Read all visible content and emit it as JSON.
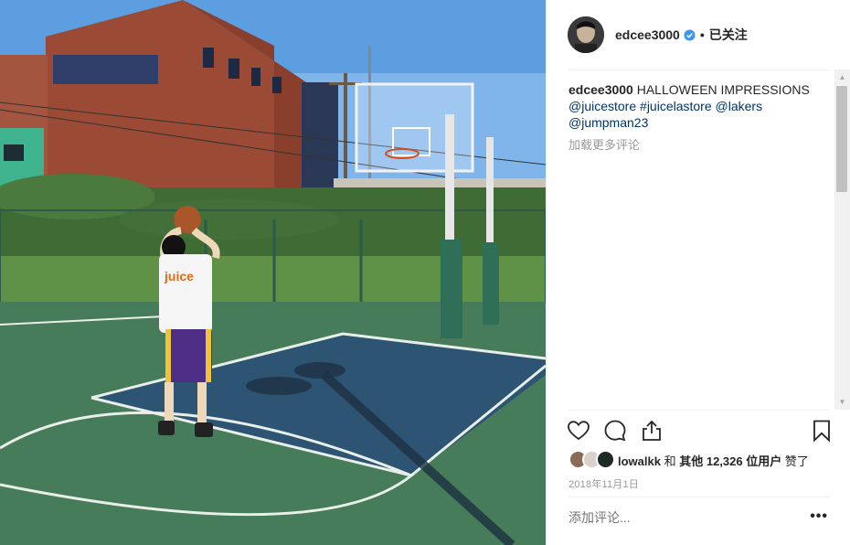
{
  "post": {
    "username": "edcee3000",
    "follow_state": "已关注",
    "separator": "•",
    "caption_text": "HALLOWEEN IMPRESSIONS",
    "tags": [
      "@juicestore",
      "#juicelastore",
      "@lakers",
      "@jumpman23"
    ],
    "load_more": "加载更多评论",
    "likes": {
      "first_user": "lowalkk",
      "joiner": "和",
      "others_label": "其他 12,326 位用户",
      "suffix": "赞了"
    },
    "date": "2018年11月1日",
    "add_comment_placeholder": "添加评论...",
    "more_label": "•••",
    "shirt_text": "juice"
  },
  "colors": {
    "tag": "#003569",
    "verified": "#3897f0",
    "muted": "#999999",
    "text": "#262626"
  },
  "icons": [
    "verified-badge-icon",
    "heart-icon",
    "comment-icon",
    "share-icon",
    "bookmark-icon",
    "more-options-icon"
  ]
}
